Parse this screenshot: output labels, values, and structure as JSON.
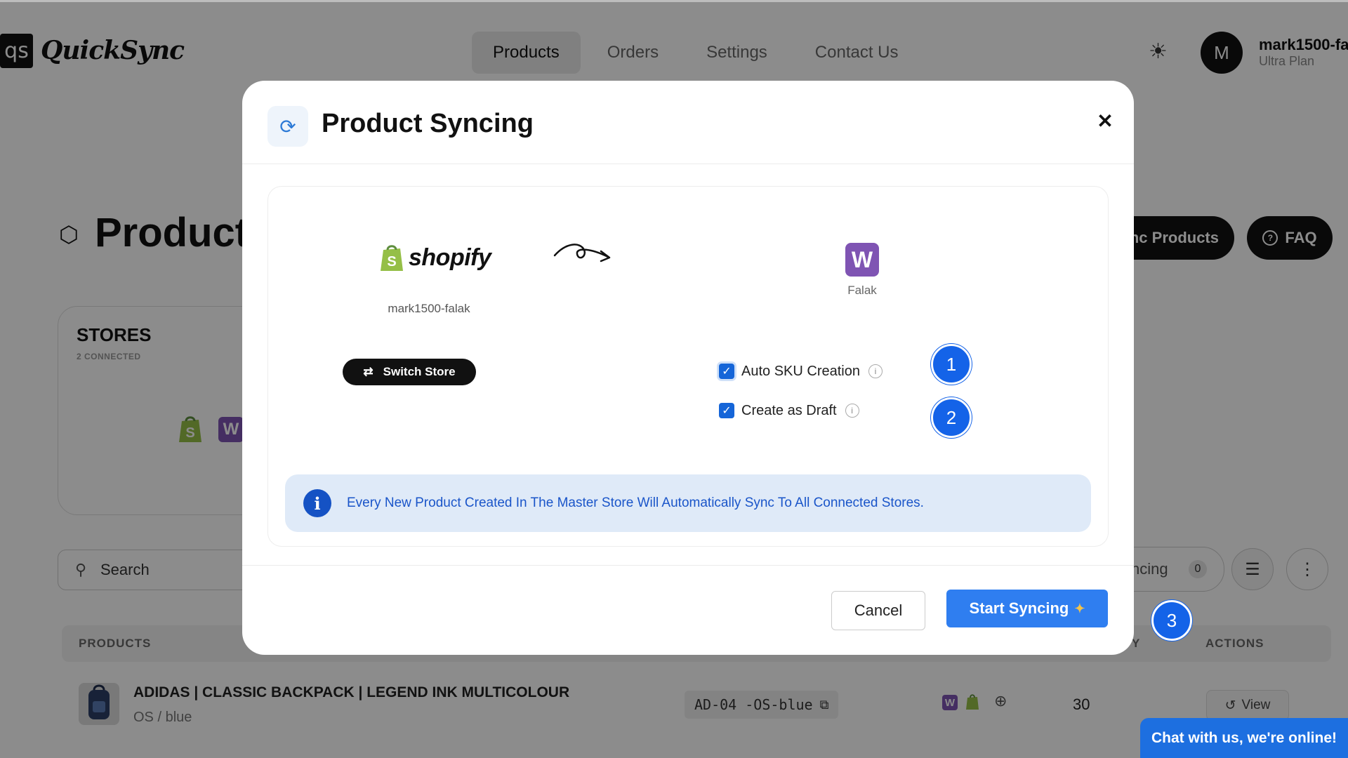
{
  "app": {
    "logo_mark": "qs",
    "logo_text": "QuickSync"
  },
  "nav": {
    "items": [
      "Products",
      "Orders",
      "Settings",
      "Contact Us"
    ],
    "active": "Products"
  },
  "user": {
    "avatar_initial": "M",
    "name": "mark1500-fa",
    "plan": "Ultra Plan"
  },
  "page": {
    "title": "Product",
    "sync_products_label": "nc Products",
    "faq_label": "FAQ",
    "stores": {
      "title": "STORES",
      "subtitle": "2 CONNECTED",
      "woo_letter": "W"
    },
    "search_label": "Search",
    "pending": {
      "label": "ncing",
      "count": "0"
    },
    "table": {
      "headers": {
        "products": "PRODUCTS",
        "qty": "Y",
        "actions": "ACTIONS"
      },
      "row": {
        "title": "ADIDAS | CLASSIC BACKPACK | LEGEND INK MULTICOLOUR",
        "variant": "OS / blue",
        "sku": "AD-04 -OS-blue",
        "woo_letter": "W",
        "qty": "30",
        "view_label": "View"
      }
    }
  },
  "modal": {
    "title": "Product Syncing",
    "source": {
      "logo_text": "shopify",
      "store_name": "mark1500-falak"
    },
    "destination": {
      "logo_letter": "W",
      "store_name": "Falak"
    },
    "switch_store_label": "Switch Store",
    "options": [
      {
        "label": "Auto SKU Creation",
        "checked": true,
        "step": "1"
      },
      {
        "label": "Create as Draft",
        "checked": true,
        "step": "2"
      }
    ],
    "info_banner": "Every New Product Created In The Master Store Will Automatically Sync To All Connected Stores.",
    "cancel_label": "Cancel",
    "start_label": "Start Syncing"
  },
  "step_badge_3": "3",
  "chat_label": "Chat with us, we're online!",
  "colors": {
    "accent_blue": "#2f7ef0",
    "badge_blue": "#1463e8",
    "woo_purple": "#7f54b3",
    "shopify_green": "#95bf47"
  }
}
